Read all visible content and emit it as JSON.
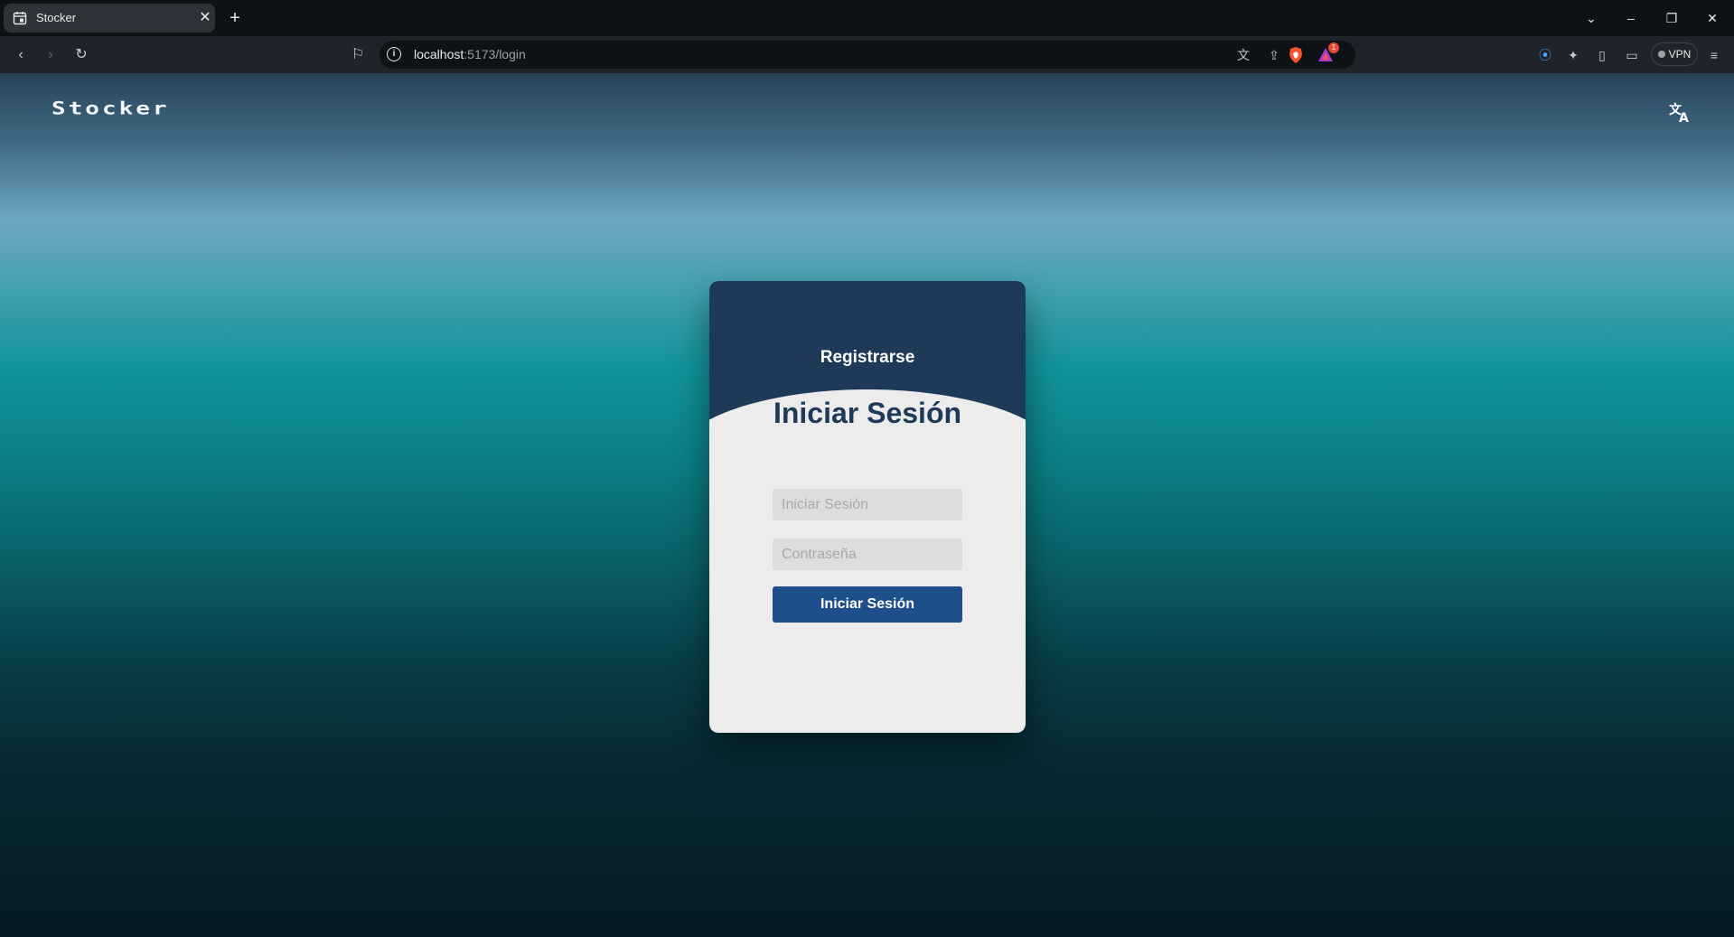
{
  "browser": {
    "tab_title": "Stocker",
    "tab_close": "✕",
    "new_tab": "+",
    "url_host": "localhost",
    "url_path": ":5173/login",
    "vpn_label": "VPN",
    "rewards_badge": "1"
  },
  "header": {
    "logo": "Stocker",
    "translate_icon": "translate-icon"
  },
  "card": {
    "register_link": "Registrarse",
    "title": "Iniciar Sesión",
    "username_placeholder": "Iniciar Sesión",
    "password_placeholder": "Contraseña",
    "submit_label": "Iniciar Sesión"
  },
  "colors": {
    "card_header": "#1e3a58",
    "card_body": "#ececec",
    "button": "#1f4e8c",
    "title": "#1e3a58"
  }
}
